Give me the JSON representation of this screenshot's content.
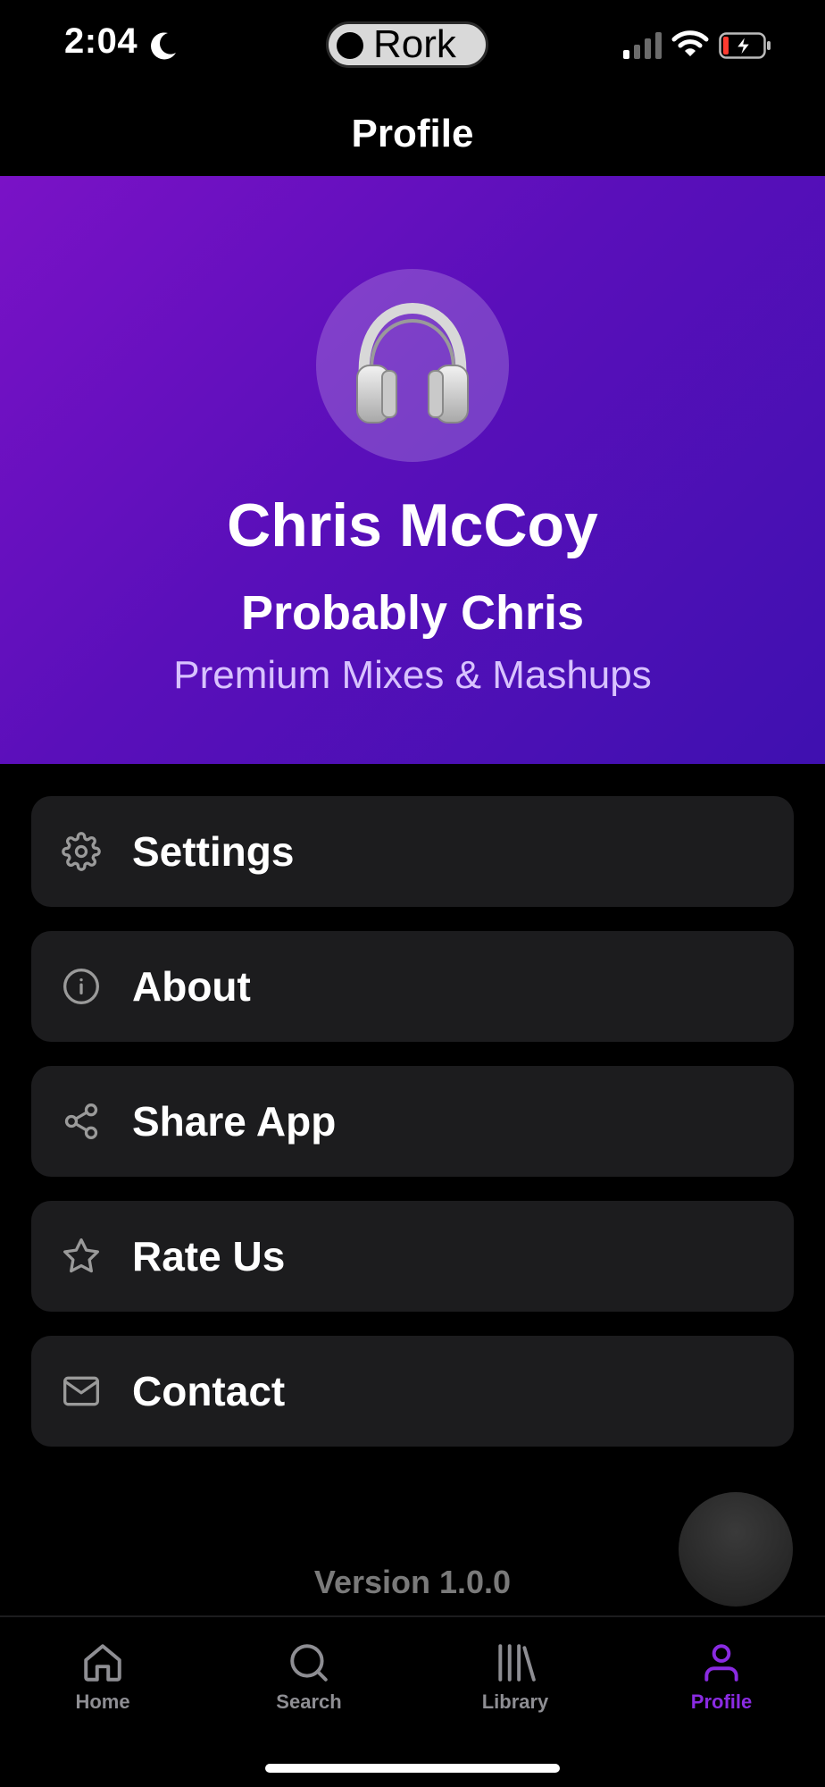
{
  "status_bar": {
    "time": "2:04",
    "carrier_pill": "Rork",
    "icons": [
      "moon-icon",
      "signal-icon",
      "wifi-icon",
      "battery-charging-icon"
    ]
  },
  "header": {
    "title": "Profile"
  },
  "profile": {
    "avatar_icon": "headphones-icon",
    "name": "Chris McCoy",
    "alias": "Probably Chris",
    "tagline": "Premium Mixes & Mashups"
  },
  "menu": [
    {
      "label": "Settings",
      "icon": "gear-icon"
    },
    {
      "label": "About",
      "icon": "info-icon"
    },
    {
      "label": "Share App",
      "icon": "share-icon"
    },
    {
      "label": "Rate Us",
      "icon": "star-icon"
    },
    {
      "label": "Contact",
      "icon": "mail-icon"
    }
  ],
  "footer": {
    "version": "Version 1.0.0"
  },
  "tabs": [
    {
      "label": "Home",
      "icon": "home-icon",
      "active": false
    },
    {
      "label": "Search",
      "icon": "search-icon",
      "active": false
    },
    {
      "label": "Library",
      "icon": "library-icon",
      "active": false
    },
    {
      "label": "Profile",
      "icon": "user-icon",
      "active": true
    }
  ],
  "colors": {
    "accent": "#8a2be2",
    "hero_gradient_start": "#7a12c6",
    "hero_gradient_end": "#3f10b0",
    "card_background": "#1c1c1e",
    "tab_inactive": "#8e8e93"
  }
}
